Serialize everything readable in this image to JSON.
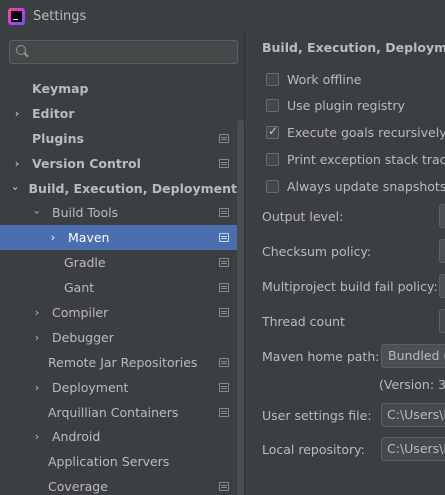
{
  "window": {
    "title": "Settings"
  },
  "search": {
    "placeholder": "",
    "value": ""
  },
  "sidebar": {
    "items": [
      {
        "label": "Keymap",
        "indent": 0,
        "arrow": "none",
        "bold": true,
        "icon": false,
        "selected": false
      },
      {
        "label": "Editor",
        "indent": 0,
        "arrow": "right",
        "bold": true,
        "icon": false,
        "selected": false
      },
      {
        "label": "Plugins",
        "indent": 0,
        "arrow": "none",
        "bold": true,
        "icon": true,
        "selected": false
      },
      {
        "label": "Version Control",
        "indent": 0,
        "arrow": "right",
        "bold": true,
        "icon": true,
        "selected": false
      },
      {
        "label": "Build, Execution, Deployment",
        "indent": 0,
        "arrow": "down",
        "bold": true,
        "icon": false,
        "selected": false
      },
      {
        "label": "Build Tools",
        "indent": 1,
        "arrow": "down",
        "bold": false,
        "icon": true,
        "selected": false
      },
      {
        "label": "Maven",
        "indent": 2,
        "arrow": "right",
        "bold": false,
        "icon": true,
        "selected": true
      },
      {
        "label": "Gradle",
        "indent": 2,
        "arrow": "none",
        "bold": false,
        "icon": true,
        "selected": false
      },
      {
        "label": "Gant",
        "indent": 2,
        "arrow": "none",
        "bold": false,
        "icon": true,
        "selected": false
      },
      {
        "label": "Compiler",
        "indent": 1,
        "arrow": "right",
        "bold": false,
        "icon": true,
        "selected": false
      },
      {
        "label": "Debugger",
        "indent": 1,
        "arrow": "right",
        "bold": false,
        "icon": false,
        "selected": false
      },
      {
        "label": "Remote Jar Repositories",
        "indent": 1,
        "arrow": "none",
        "bold": false,
        "icon": true,
        "selected": false
      },
      {
        "label": "Deployment",
        "indent": 1,
        "arrow": "right",
        "bold": false,
        "icon": true,
        "selected": false
      },
      {
        "label": "Arquillian Containers",
        "indent": 1,
        "arrow": "none",
        "bold": false,
        "icon": true,
        "selected": false
      },
      {
        "label": "Android",
        "indent": 1,
        "arrow": "right",
        "bold": false,
        "icon": false,
        "selected": false
      },
      {
        "label": "Application Servers",
        "indent": 1,
        "arrow": "none",
        "bold": false,
        "icon": false,
        "selected": false
      },
      {
        "label": "Coverage",
        "indent": 1,
        "arrow": "none",
        "bold": false,
        "icon": true,
        "selected": false
      }
    ]
  },
  "main": {
    "title": "Build, Execution, Deployment",
    "checkboxes": [
      {
        "label": "Work offline",
        "checked": false
      },
      {
        "label": "Use plugin registry",
        "checked": false
      },
      {
        "label": "Execute goals recursively",
        "checked": true
      },
      {
        "label": "Print exception stack traces",
        "checked": false
      },
      {
        "label": "Always update snapshots",
        "checked": false
      }
    ],
    "output_level_label": "Output level:",
    "checksum_policy_label": "Checksum policy:",
    "multiproject_label": "Multiproject build fail policy:",
    "thread_count_label": "Thread count",
    "maven_home_label": "Maven home path:",
    "maven_home_value": "Bundled (",
    "version_note": "(Version: 3.",
    "user_settings_label": "User settings file:",
    "user_settings_value": "C:\\Users\\E",
    "local_repo_label": "Local repository:",
    "local_repo_value": "C:\\Users\\E"
  },
  "colors": {
    "background": "#3c3f41",
    "selection": "#4b6eaf",
    "text": "#bbbbbb"
  }
}
